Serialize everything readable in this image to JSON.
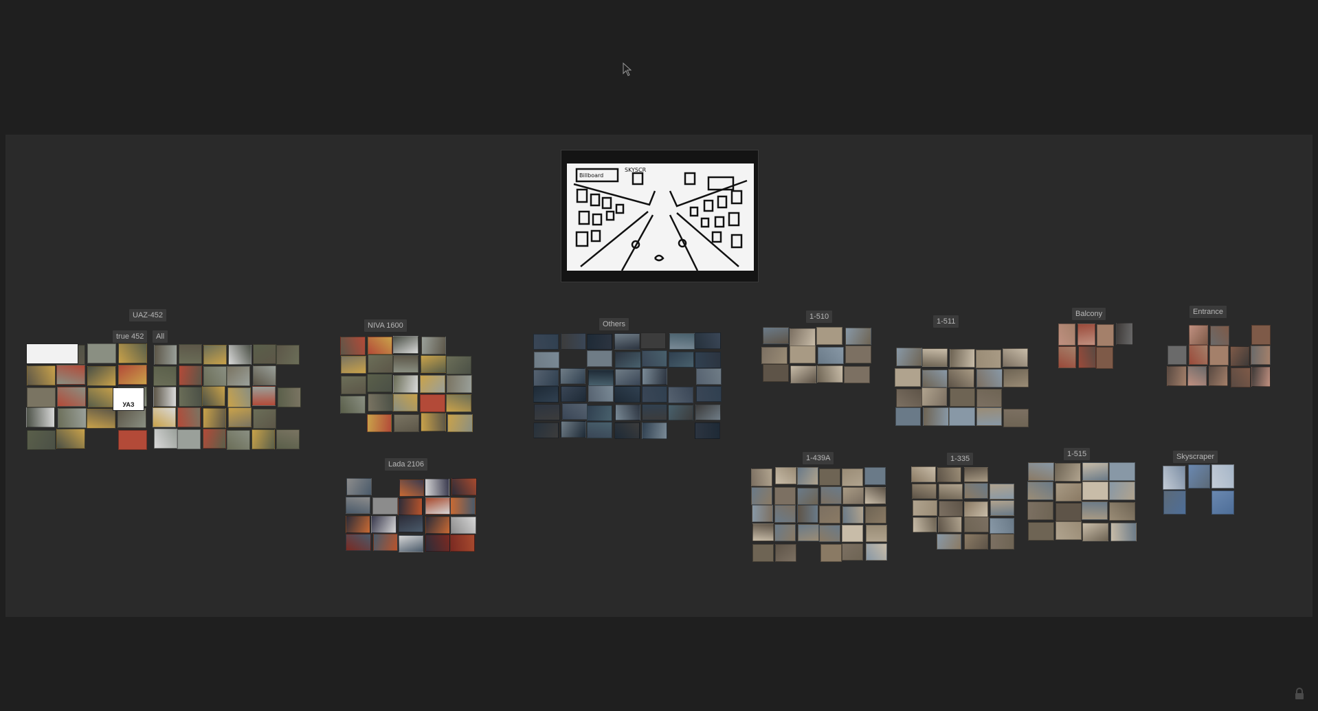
{
  "canvas": {
    "background": "#1f1f1f",
    "board_color": "#2a2a2a",
    "label_color": "#3b3b3b",
    "label_text_color": "#b8b8b8"
  },
  "sketch": {
    "text_1": "Billboard",
    "text_2": "SKYSCR"
  },
  "groups": {
    "uaz": "UAZ-452",
    "uaz_true": "true 452",
    "uaz_all": "All",
    "niva": "NIVA 1600",
    "lada": "Lada 2106",
    "others": "Others",
    "s510": "1-510",
    "s511": "1-511",
    "balcony": "Balcony",
    "entrance": "Entrance",
    "s439a": "1-439A",
    "s335": "1-335",
    "s515": "1-515",
    "skyscraper": "Skyscraper"
  },
  "logo": {
    "uaz_text": "УАЗ"
  },
  "icons": {
    "cursor": "pointer-cursor-icon",
    "lock": "lock-icon"
  }
}
